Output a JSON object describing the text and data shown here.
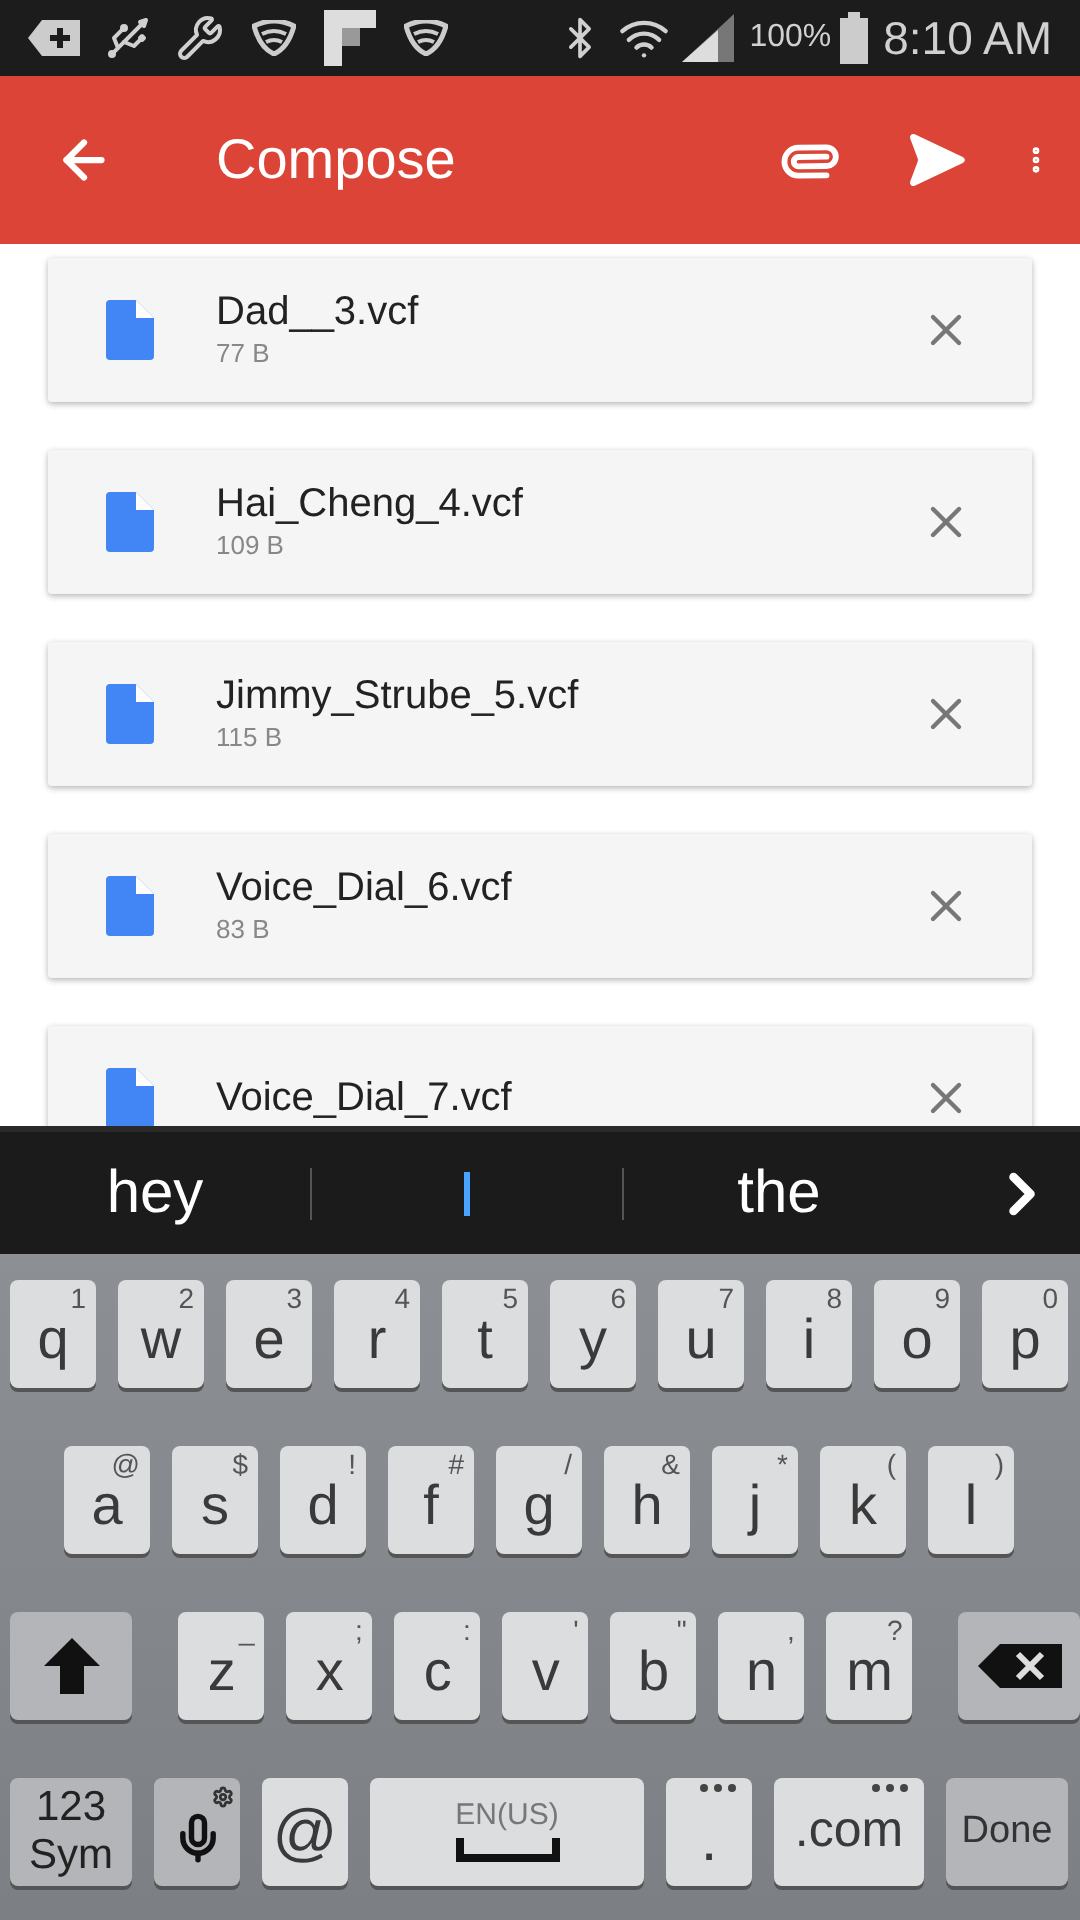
{
  "status_bar": {
    "battery": "100%",
    "time": "8:10 AM"
  },
  "app_bar": {
    "title": "Compose"
  },
  "attachments": [
    {
      "name": "Dad__3.vcf",
      "size": "77 B"
    },
    {
      "name": "Hai_Cheng_4.vcf",
      "size": "109 B"
    },
    {
      "name": "Jimmy_Strube_5.vcf",
      "size": "115 B"
    },
    {
      "name": "Voice_Dial_6.vcf",
      "size": "83 B"
    },
    {
      "name": "Voice_Dial_7.vcf"
    }
  ],
  "suggestions": [
    {
      "kind": "word",
      "text": "hey"
    },
    {
      "kind": "cursor"
    },
    {
      "kind": "word",
      "text": "the"
    }
  ],
  "keyboard": {
    "rows": [
      {
        "keys": [
          {
            "kind": "letter",
            "label": "q",
            "hint": "1"
          },
          {
            "kind": "letter",
            "label": "w",
            "hint": "2"
          },
          {
            "kind": "letter",
            "label": "e",
            "hint": "3"
          },
          {
            "kind": "letter",
            "label": "r",
            "hint": "4"
          },
          {
            "kind": "letter",
            "label": "t",
            "hint": "5"
          },
          {
            "kind": "letter",
            "label": "y",
            "hint": "6"
          },
          {
            "kind": "letter",
            "label": "u",
            "hint": "7"
          },
          {
            "kind": "letter",
            "label": "i",
            "hint": "8"
          },
          {
            "kind": "letter",
            "label": "o",
            "hint": "9"
          },
          {
            "kind": "letter",
            "label": "p",
            "hint": "0"
          }
        ]
      },
      {
        "keys": [
          {
            "kind": "letter",
            "label": "a",
            "hint": "@"
          },
          {
            "kind": "letter",
            "label": "s",
            "hint": "$"
          },
          {
            "kind": "letter",
            "label": "d",
            "hint": "!"
          },
          {
            "kind": "letter",
            "label": "f",
            "hint": "#"
          },
          {
            "kind": "letter",
            "label": "g",
            "hint": "/"
          },
          {
            "kind": "letter",
            "label": "h",
            "hint": "&"
          },
          {
            "kind": "letter",
            "label": "j",
            "hint": "*"
          },
          {
            "kind": "letter",
            "label": "k",
            "hint": "("
          },
          {
            "kind": "letter",
            "label": "l",
            "hint": ")"
          }
        ]
      },
      {
        "keys": [
          {
            "kind": "shift"
          },
          {
            "kind": "letter",
            "label": "z",
            "hint": "_"
          },
          {
            "kind": "letter",
            "label": "x",
            "hint": ";"
          },
          {
            "kind": "letter",
            "label": "c",
            "hint": ":"
          },
          {
            "kind": "letter",
            "label": "v",
            "hint": "'"
          },
          {
            "kind": "letter",
            "label": "b",
            "hint": "\""
          },
          {
            "kind": "letter",
            "label": "n",
            "hint": ","
          },
          {
            "kind": "letter",
            "label": "m",
            "hint": "?"
          },
          {
            "kind": "backspace"
          }
        ]
      },
      {
        "keys": [
          {
            "kind": "sym",
            "lines": [
              "123",
              "Sym"
            ]
          },
          {
            "kind": "mic"
          },
          {
            "kind": "at",
            "label": "@"
          },
          {
            "kind": "space",
            "label": "EN(US)"
          },
          {
            "kind": "period",
            "label": "."
          },
          {
            "kind": "dotcom",
            "label": ".com"
          },
          {
            "kind": "done",
            "label": "Done"
          }
        ]
      }
    ]
  }
}
